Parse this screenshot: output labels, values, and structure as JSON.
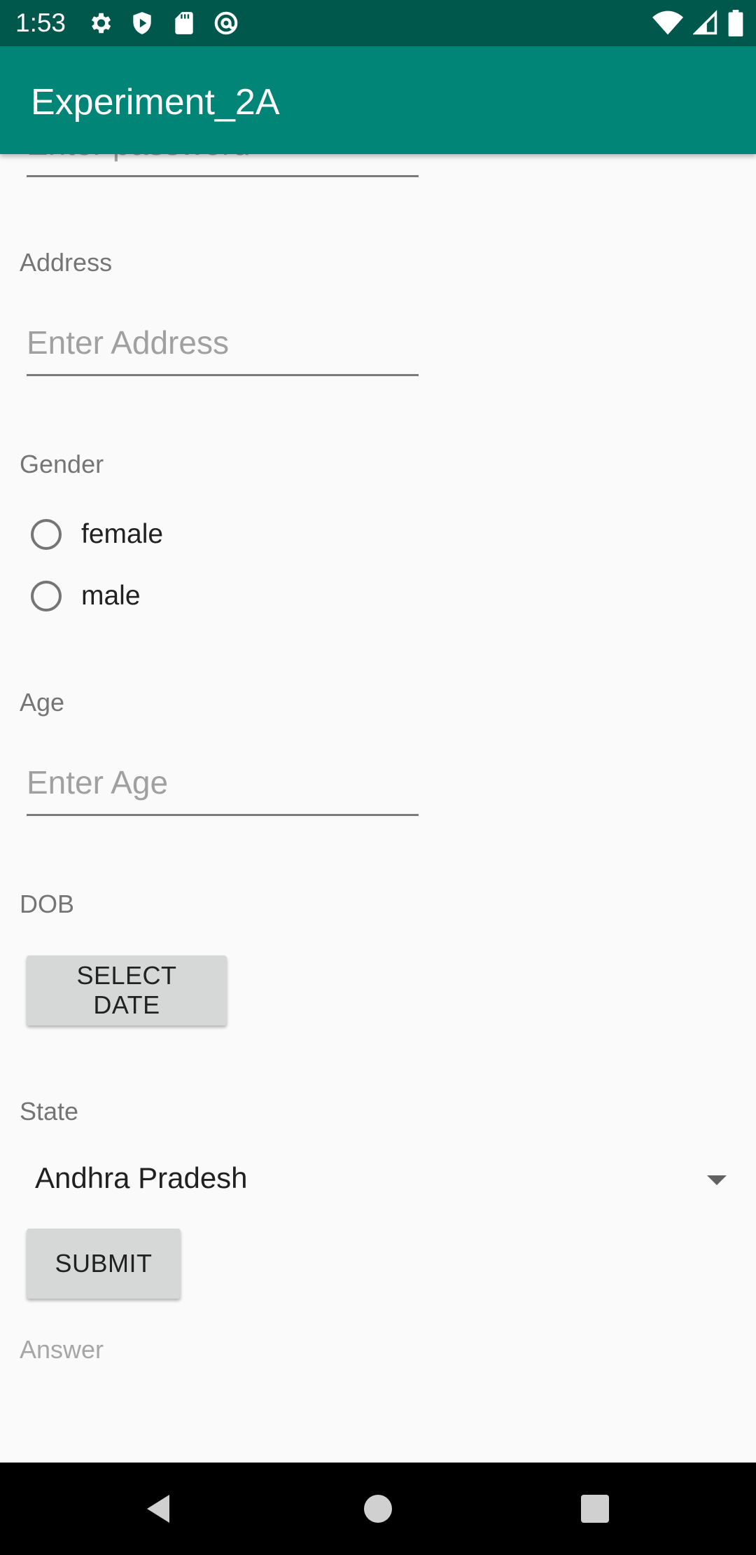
{
  "status_bar": {
    "time": "1:53",
    "left_icons": [
      "settings-icon",
      "shield-icon",
      "sd-card-icon",
      "at-sign-icon"
    ],
    "right_icons": [
      "wifi-icon",
      "signal-icon",
      "battery-icon"
    ]
  },
  "app_bar": {
    "title": "Experiment_2A",
    "color": "#008577",
    "status_color": "#00574b"
  },
  "form": {
    "password": {
      "placeholder": "Enter password"
    },
    "address": {
      "label": "Address",
      "placeholder": "Enter Address"
    },
    "gender": {
      "label": "Gender",
      "options": [
        {
          "label": "female",
          "selected": false
        },
        {
          "label": "male",
          "selected": false
        }
      ]
    },
    "age": {
      "label": "Age",
      "placeholder": "Enter Age"
    },
    "dob": {
      "label": "DOB",
      "button_label": "SELECT DATE"
    },
    "state": {
      "label": "State",
      "selected": "Andhra Pradesh"
    },
    "submit_label": "SUBMIT",
    "answer_label": "Answer"
  },
  "nav_bar": {
    "buttons": [
      "back-icon",
      "home-icon",
      "recents-icon"
    ]
  }
}
